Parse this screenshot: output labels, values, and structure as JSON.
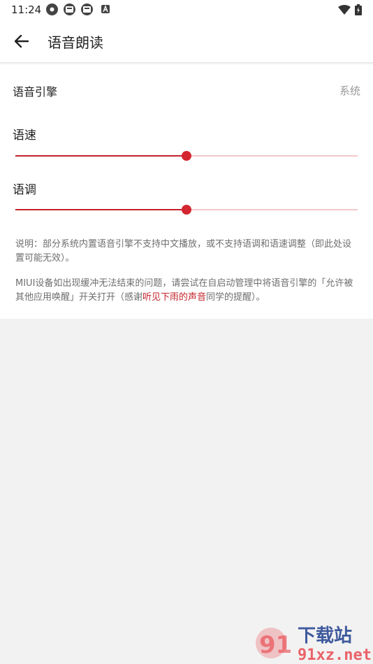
{
  "status_bar": {
    "time": "11:24"
  },
  "app_bar": {
    "title": "语音朗读",
    "back_icon": "arrow-left-icon"
  },
  "settings": {
    "engine": {
      "label": "语音引擎",
      "value": "系统"
    },
    "speed": {
      "label": "语速",
      "level": 0.5
    },
    "pitch": {
      "label": "语调",
      "level": 0.5
    }
  },
  "notes": {
    "note1": "说明：部分系统内置语音引擎不支持中文播放，或不支持语调和语速调整（即此处设置可能无效）。",
    "note2_part1": "MIUI设备如出现缓冲无法结束的问题，请尝试在自启动管理中将语音引擎的「允许被其他应用唤醒」开关打开（感谢",
    "note2_link": "听见下雨的声音",
    "note2_part2": "同学的提醒）。"
  },
  "watermark": {
    "logo_text": "91",
    "brand_text": "下载站",
    "domain": "91xz.net"
  },
  "colors": {
    "accent": "#c4232b",
    "track_inactive": "#f2c9c9",
    "background": "#f2f2f2"
  }
}
